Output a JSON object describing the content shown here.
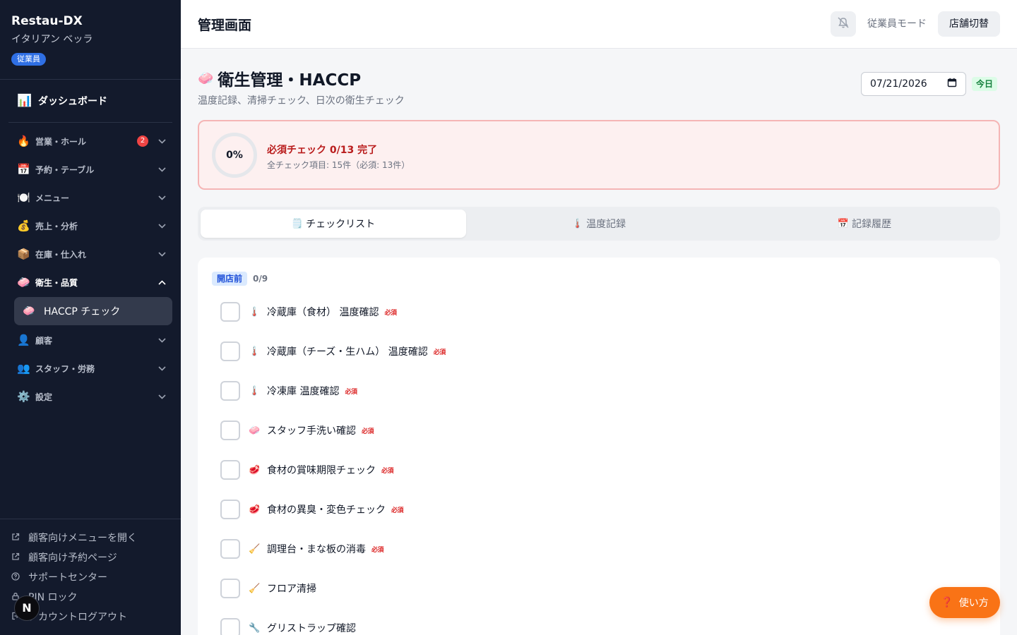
{
  "sidebar": {
    "brand_title": "Restau-DX",
    "store_name": "イタリアン ベッラ",
    "role_badge": "従業員",
    "dashboard": {
      "icon": "📊",
      "label": "ダッシュボード"
    },
    "items": [
      {
        "icon": "🔥",
        "label": "営業・ホール",
        "badge": "2",
        "expanded": false
      },
      {
        "icon": "📅",
        "label": "予約・テーブル",
        "expanded": false
      },
      {
        "icon": "🍽️",
        "label": "メニュー",
        "expanded": false
      },
      {
        "icon": "💰",
        "label": "売上・分析",
        "expanded": false
      },
      {
        "icon": "📦",
        "label": "在庫・仕入れ",
        "expanded": false
      },
      {
        "icon": "🧼",
        "label": "衛生・品質",
        "expanded": true
      },
      {
        "icon": "👤",
        "label": "顧客",
        "expanded": false
      },
      {
        "icon": "👥",
        "label": "スタッフ・労務",
        "expanded": false
      },
      {
        "icon": "⚙️",
        "label": "設定",
        "expanded": false
      }
    ],
    "sub_item": {
      "icon": "🧼",
      "label": "HACCP チェック"
    },
    "footer": [
      {
        "icon": "external-link-icon",
        "label": "顧客向けメニューを開く"
      },
      {
        "icon": "external-link-icon",
        "label": "顧客向け予約ページ"
      },
      {
        "icon": "help-circle-icon",
        "label": "サポートセンター"
      },
      {
        "icon": "lock-icon",
        "label": "PIN ロック"
      },
      {
        "icon": "logout-icon",
        "label": "アカウントログアウト"
      }
    ],
    "n_bubble": "N"
  },
  "header": {
    "title": "管理画面",
    "mode_label": "従業員モード",
    "store_switch": "店舗切替"
  },
  "page": {
    "title_icon": "🧼",
    "title": "衛生管理・HACCP",
    "subtitle": "温度記録、清掃チェック、日次の衛生チェック",
    "date_value": "07/21/2026",
    "today_badge": "今日"
  },
  "progress": {
    "percent_label": "0%",
    "main": "必須チェック 0/13 完了",
    "sub": "全チェック項目: 15件（必須: 13件）",
    "completed": 0,
    "required_total": 13
  },
  "tabs": [
    {
      "icon": "🗒️",
      "label": "チェックリスト",
      "active": true
    },
    {
      "icon": "🌡️",
      "label": "温度記録",
      "active": false
    },
    {
      "icon": "📅",
      "label": "記録履歴",
      "active": false
    }
  ],
  "section": {
    "phase": "開店前",
    "count": "0/9",
    "items": [
      {
        "icon": "🌡️",
        "label": "冷蔵庫（食材） 温度確認",
        "required": "必須"
      },
      {
        "icon": "🌡️",
        "label": "冷蔵庫（チーズ・生ハム） 温度確認",
        "required": "必須"
      },
      {
        "icon": "🌡️",
        "label": "冷凍庫 温度確認",
        "required": "必須"
      },
      {
        "icon": "🧼",
        "label": "スタッフ手洗い確認",
        "required": "必須"
      },
      {
        "icon": "🥩",
        "label": "食材の賞味期限チェック",
        "required": "必須"
      },
      {
        "icon": "🥩",
        "label": "食材の異臭・変色チェック",
        "required": "必須"
      },
      {
        "icon": "🧹",
        "label": "調理台・まな板の消毒",
        "required": "必須"
      },
      {
        "icon": "🧹",
        "label": "フロア清掃",
        "required": ""
      },
      {
        "icon": "🔧",
        "label": "グリストラップ確認",
        "required": ""
      }
    ]
  },
  "help_button": {
    "icon": "❓",
    "label": "使い方"
  }
}
